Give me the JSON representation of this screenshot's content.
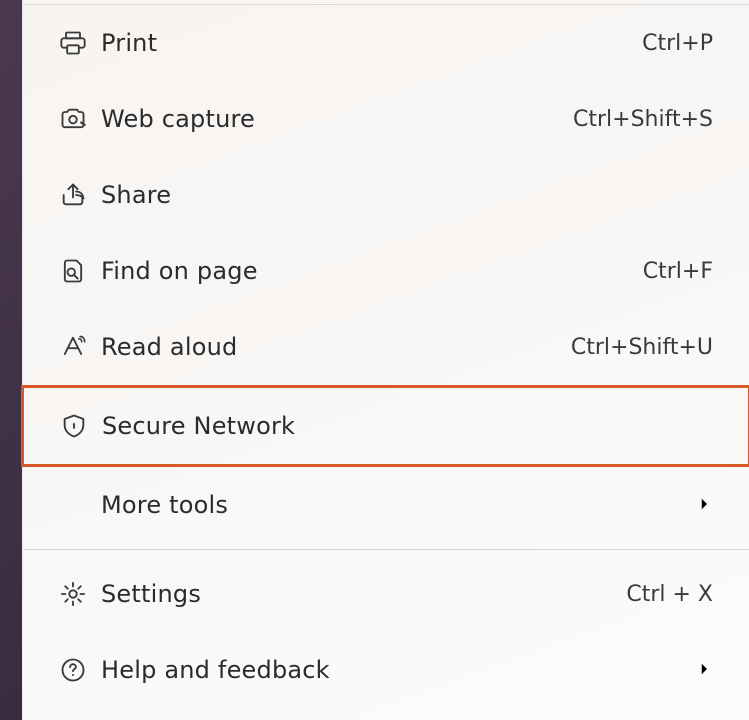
{
  "menu": {
    "print": {
      "label": "Print",
      "shortcut": "Ctrl+P"
    },
    "webCapture": {
      "label": "Web capture",
      "shortcut": "Ctrl+Shift+S"
    },
    "share": {
      "label": "Share",
      "shortcut": ""
    },
    "findOnPage": {
      "label": "Find on page",
      "shortcut": "Ctrl+F"
    },
    "readAloud": {
      "label": "Read aloud",
      "shortcut": "Ctrl+Shift+U"
    },
    "secureNetwork": {
      "label": "Secure Network",
      "shortcut": ""
    },
    "moreTools": {
      "label": "More tools",
      "shortcut": ""
    },
    "settings": {
      "label": "Settings",
      "shortcut": "Ctrl + X"
    },
    "help": {
      "label": "Help and feedback",
      "shortcut": ""
    }
  },
  "colors": {
    "highlight": "#d65a2a"
  }
}
